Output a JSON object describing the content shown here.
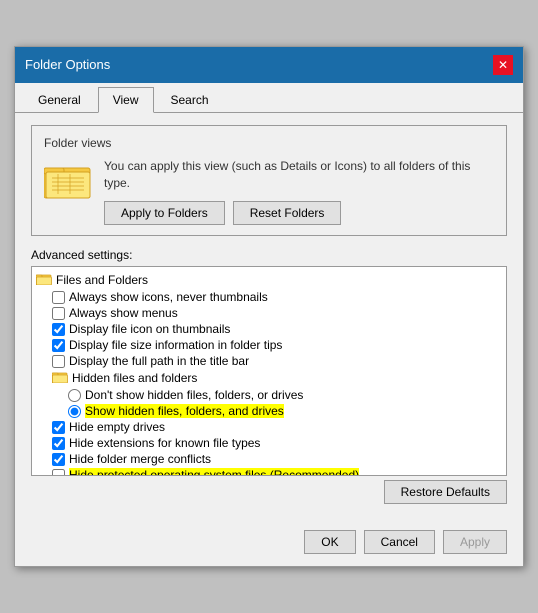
{
  "titleBar": {
    "title": "Folder Options",
    "closeLabel": "✕"
  },
  "tabs": [
    {
      "label": "General",
      "active": false
    },
    {
      "label": "View",
      "active": true
    },
    {
      "label": "Search",
      "active": false
    }
  ],
  "folderViews": {
    "sectionLabel": "Folder views",
    "description": "You can apply this view (such as Details or Icons) to all folders of this type.",
    "applyToFoldersLabel": "Apply to Folders",
    "resetFoldersLabel": "Reset Folders"
  },
  "advancedSettings": {
    "label": "Advanced settings:",
    "items": [
      {
        "type": "folder-header",
        "indent": 0,
        "label": "Files and Folders"
      },
      {
        "type": "checkbox",
        "indent": 1,
        "checked": false,
        "label": "Always show icons, never thumbnails"
      },
      {
        "type": "checkbox",
        "indent": 1,
        "checked": false,
        "label": "Always show menus"
      },
      {
        "type": "checkbox",
        "indent": 1,
        "checked": true,
        "label": "Display file icon on thumbnails"
      },
      {
        "type": "checkbox",
        "indent": 1,
        "checked": true,
        "label": "Display file size information in folder tips"
      },
      {
        "type": "checkbox",
        "indent": 1,
        "checked": false,
        "label": "Display the full path in the title bar"
      },
      {
        "type": "folder-header",
        "indent": 1,
        "label": "Hidden files and folders"
      },
      {
        "type": "radio",
        "indent": 2,
        "checked": false,
        "label": "Don't show hidden files, folders, or drives"
      },
      {
        "type": "radio",
        "indent": 2,
        "checked": true,
        "label": "Show hidden files, folders, and drives",
        "highlight": true
      },
      {
        "type": "checkbox",
        "indent": 1,
        "checked": true,
        "label": "Hide empty drives"
      },
      {
        "type": "checkbox",
        "indent": 1,
        "checked": true,
        "label": "Hide extensions for known file types"
      },
      {
        "type": "checkbox",
        "indent": 1,
        "checked": true,
        "label": "Hide folder merge conflicts"
      },
      {
        "type": "checkbox",
        "indent": 1,
        "checked": false,
        "label": "Hide protected operating system files (Recommended)",
        "highlight": true
      }
    ]
  },
  "restoreDefaultsLabel": "Restore Defaults",
  "buttons": {
    "ok": "OK",
    "cancel": "Cancel",
    "apply": "Apply"
  }
}
